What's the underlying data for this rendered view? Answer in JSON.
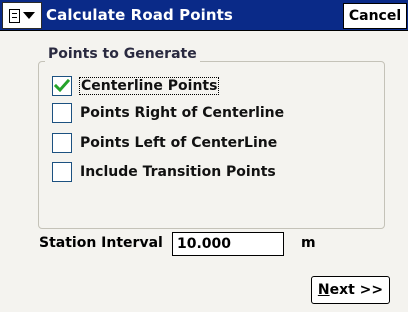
{
  "window": {
    "title": "Calculate Road Points",
    "menu_icon": "document-menu-icon",
    "cancel_label": "Cancel",
    "title_bar_color": "#0a2a88"
  },
  "group": {
    "legend": "Points to Generate",
    "options": [
      {
        "label": "Centerline Points",
        "checked": true
      },
      {
        "label": "Points Right of Centerline",
        "checked": false
      },
      {
        "label": "Points Left of CenterLine",
        "checked": false
      },
      {
        "label": "Include Transition Points",
        "checked": false
      }
    ]
  },
  "station_interval": {
    "label": "Station Interval",
    "value": "10.000",
    "unit": "m"
  },
  "next_button": {
    "mnemonic": "N",
    "rest": "ext >>"
  },
  "check_color": "#24a32a"
}
